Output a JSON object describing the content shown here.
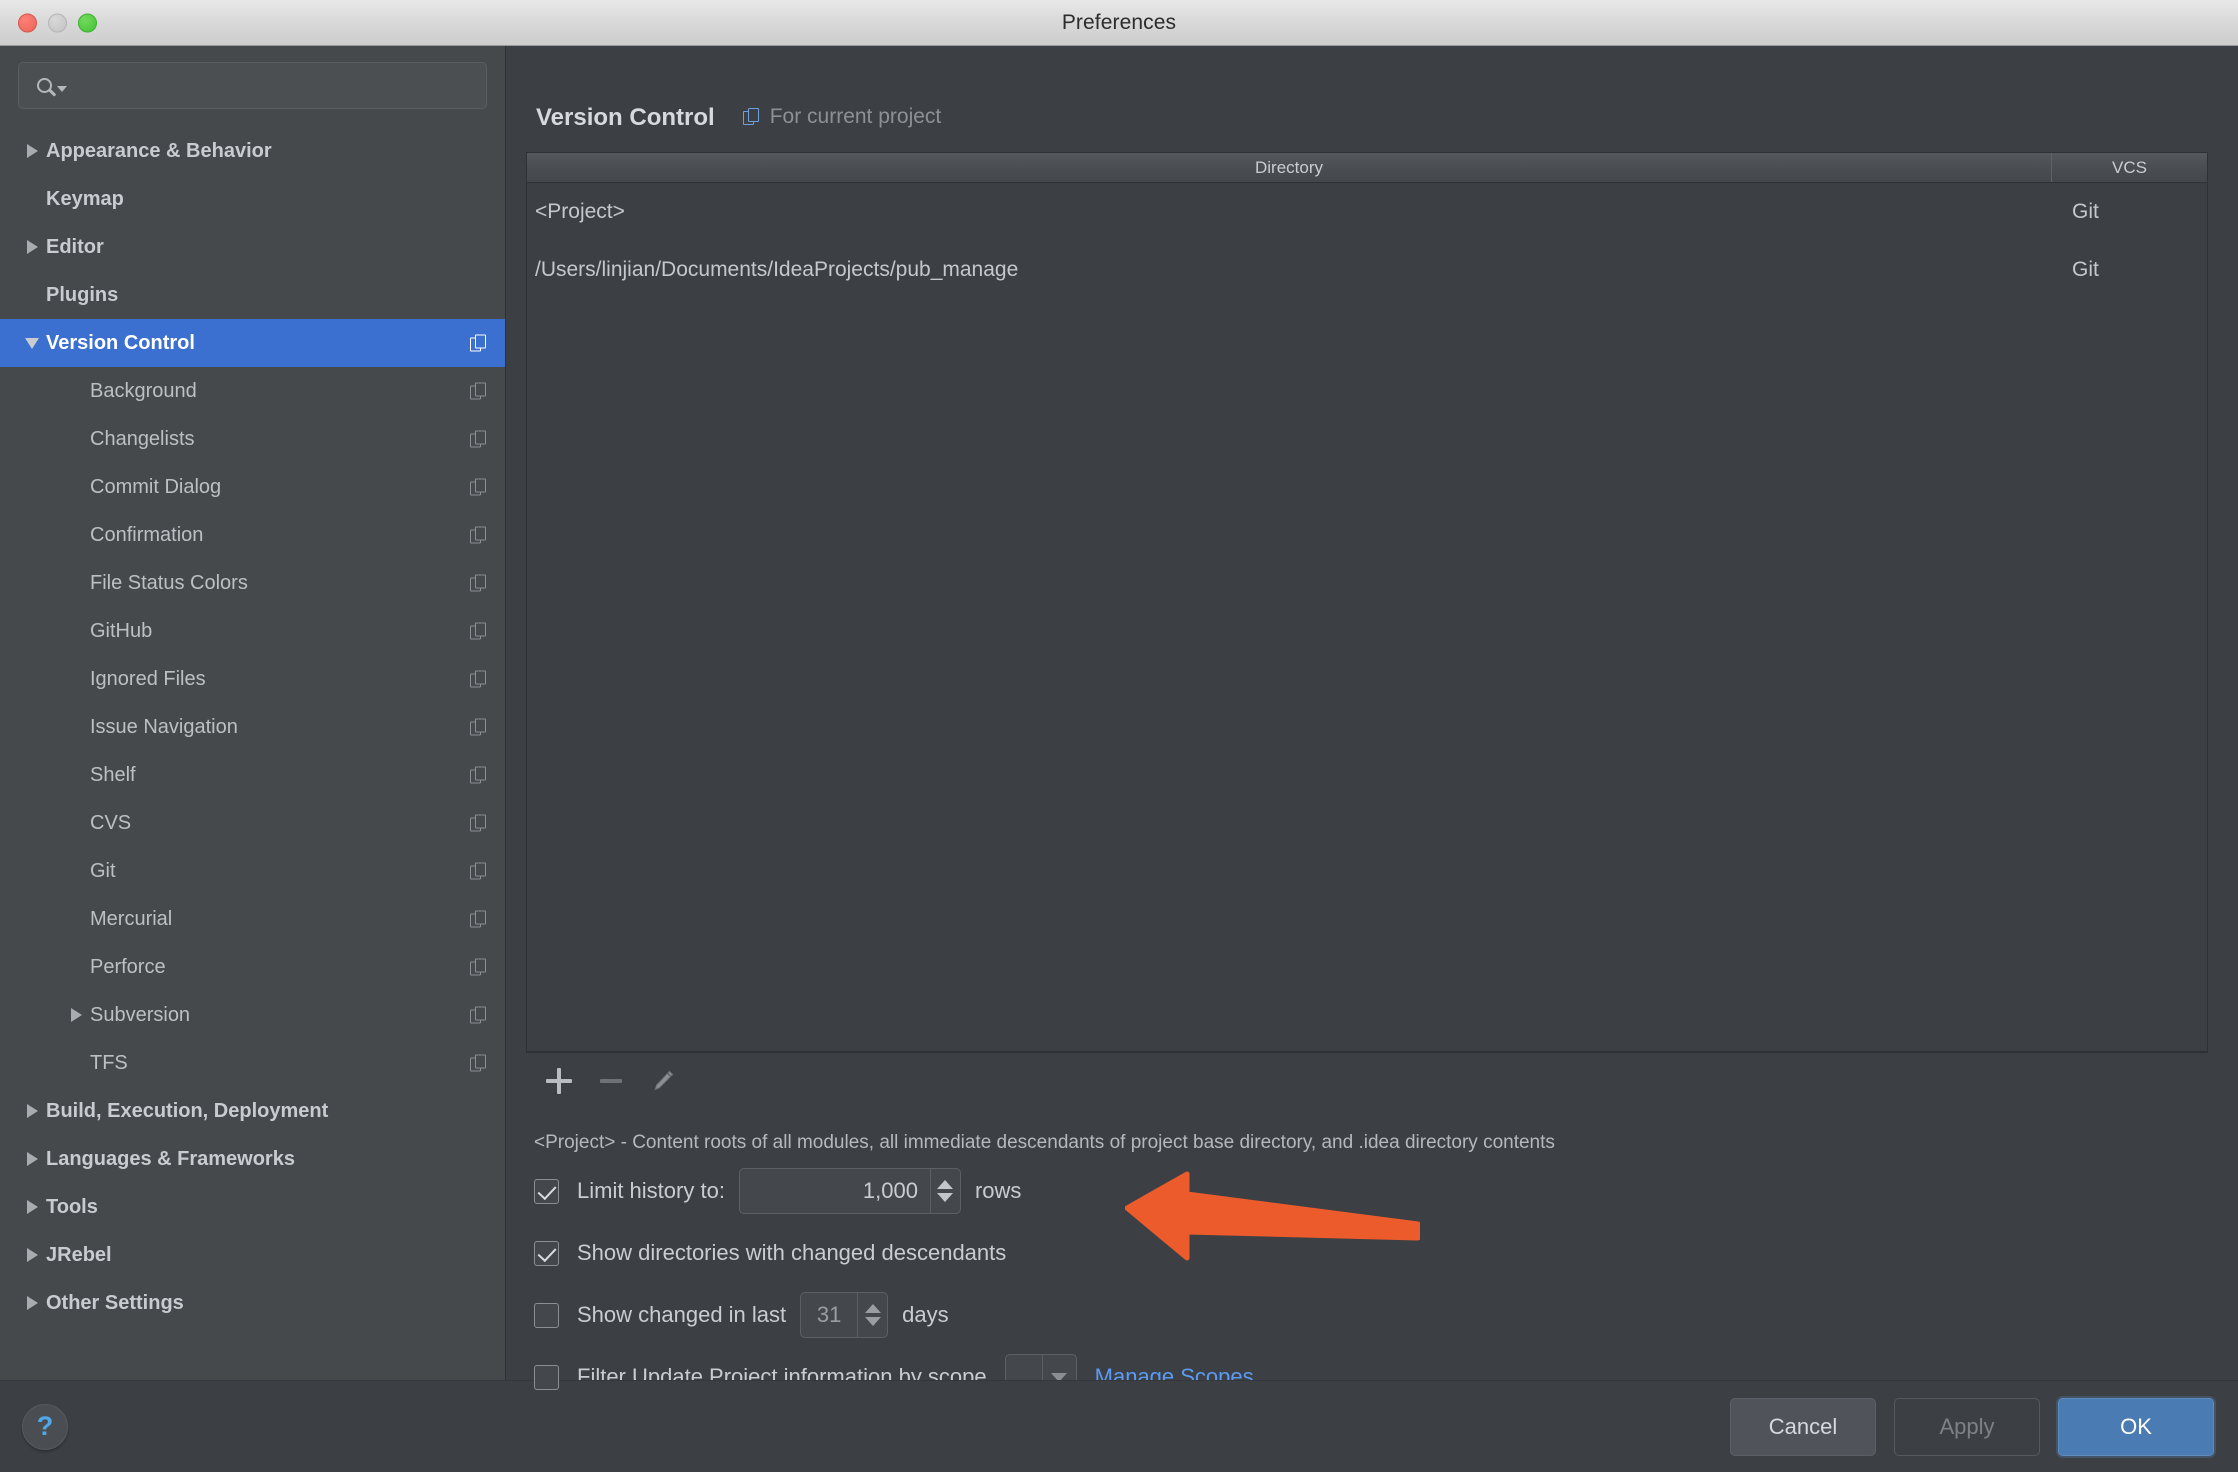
{
  "window": {
    "title": "Preferences",
    "traffic_lights": [
      "close",
      "minimize",
      "maximize"
    ]
  },
  "search": {
    "value": "",
    "placeholder": ""
  },
  "sidebar": {
    "items": [
      {
        "label": "Appearance & Behavior",
        "level": 0,
        "twisty": "right",
        "bold": true,
        "selected": false,
        "copy": false
      },
      {
        "label": "Keymap",
        "level": 0,
        "twisty": "none",
        "bold": true,
        "selected": false,
        "copy": false
      },
      {
        "label": "Editor",
        "level": 0,
        "twisty": "right",
        "bold": true,
        "selected": false,
        "copy": false
      },
      {
        "label": "Plugins",
        "level": 0,
        "twisty": "none",
        "bold": true,
        "selected": false,
        "copy": false
      },
      {
        "label": "Version Control",
        "level": 0,
        "twisty": "down",
        "bold": true,
        "selected": true,
        "copy": true
      },
      {
        "label": "Background",
        "level": 1,
        "twisty": "none",
        "bold": false,
        "selected": false,
        "copy": true
      },
      {
        "label": "Changelists",
        "level": 1,
        "twisty": "none",
        "bold": false,
        "selected": false,
        "copy": true
      },
      {
        "label": "Commit Dialog",
        "level": 1,
        "twisty": "none",
        "bold": false,
        "selected": false,
        "copy": true
      },
      {
        "label": "Confirmation",
        "level": 1,
        "twisty": "none",
        "bold": false,
        "selected": false,
        "copy": true
      },
      {
        "label": "File Status Colors",
        "level": 1,
        "twisty": "none",
        "bold": false,
        "selected": false,
        "copy": true
      },
      {
        "label": "GitHub",
        "level": 1,
        "twisty": "none",
        "bold": false,
        "selected": false,
        "copy": true
      },
      {
        "label": "Ignored Files",
        "level": 1,
        "twisty": "none",
        "bold": false,
        "selected": false,
        "copy": true
      },
      {
        "label": "Issue Navigation",
        "level": 1,
        "twisty": "none",
        "bold": false,
        "selected": false,
        "copy": true
      },
      {
        "label": "Shelf",
        "level": 1,
        "twisty": "none",
        "bold": false,
        "selected": false,
        "copy": true
      },
      {
        "label": "CVS",
        "level": 1,
        "twisty": "none",
        "bold": false,
        "selected": false,
        "copy": true
      },
      {
        "label": "Git",
        "level": 1,
        "twisty": "none",
        "bold": false,
        "selected": false,
        "copy": true
      },
      {
        "label": "Mercurial",
        "level": 1,
        "twisty": "none",
        "bold": false,
        "selected": false,
        "copy": true
      },
      {
        "label": "Perforce",
        "level": 1,
        "twisty": "none",
        "bold": false,
        "selected": false,
        "copy": true
      },
      {
        "label": "Subversion",
        "level": 1,
        "twisty": "right",
        "bold": false,
        "selected": false,
        "copy": true
      },
      {
        "label": "TFS",
        "level": 1,
        "twisty": "none",
        "bold": false,
        "selected": false,
        "copy": true
      },
      {
        "label": "Build, Execution, Deployment",
        "level": 0,
        "twisty": "right",
        "bold": true,
        "selected": false,
        "copy": false
      },
      {
        "label": "Languages & Frameworks",
        "level": 0,
        "twisty": "right",
        "bold": true,
        "selected": false,
        "copy": false
      },
      {
        "label": "Tools",
        "level": 0,
        "twisty": "right",
        "bold": true,
        "selected": false,
        "copy": false
      },
      {
        "label": "JRebel",
        "level": 0,
        "twisty": "right",
        "bold": true,
        "selected": false,
        "copy": false
      },
      {
        "label": "Other Settings",
        "level": 0,
        "twisty": "right",
        "bold": true,
        "selected": false,
        "copy": false
      }
    ]
  },
  "main": {
    "title": "Version Control",
    "scope_note": "For current project",
    "table": {
      "columns": [
        "Directory",
        "VCS"
      ],
      "rows": [
        {
          "directory": "<Project>",
          "vcs": "Git"
        },
        {
          "directory": "/Users/linjian/Documents/IdeaProjects/pub_manage",
          "vcs": "Git"
        }
      ]
    },
    "toolbar": {
      "add_label": "+",
      "remove_label": "−",
      "edit_label": "edit"
    },
    "hint": "<Project> - Content roots of all modules, all immediate descendants of project base directory, and .idea directory contents",
    "options": {
      "limit_history": {
        "label": "Limit history to:",
        "checked": true,
        "value": "1,000",
        "suffix": "rows"
      },
      "show_directories": {
        "label": "Show directories with changed descendants",
        "checked": true
      },
      "show_changed_in_last": {
        "label": "Show changed in last",
        "checked": false,
        "value": "31",
        "suffix": "days"
      },
      "filter_by_scope": {
        "label": "Filter Update Project information by scope",
        "checked": false,
        "scope_value": "",
        "manage_link": "Manage Scopes"
      }
    }
  },
  "footer": {
    "help_label": "?",
    "cancel_label": "Cancel",
    "apply_label": "Apply",
    "ok_label": "OK"
  },
  "annotation": {
    "type": "arrow",
    "direction": "left",
    "color": "#ec5b2b",
    "points_at": "Show directories with changed descendants"
  },
  "colors": {
    "accent_selection": "#3b6fd0",
    "link": "#5b9bf5",
    "ok_button": "#4a7bb3",
    "annotation": "#ec5b2b",
    "panel_bg": "#3c4044",
    "sidebar_bg": "#45494c"
  }
}
